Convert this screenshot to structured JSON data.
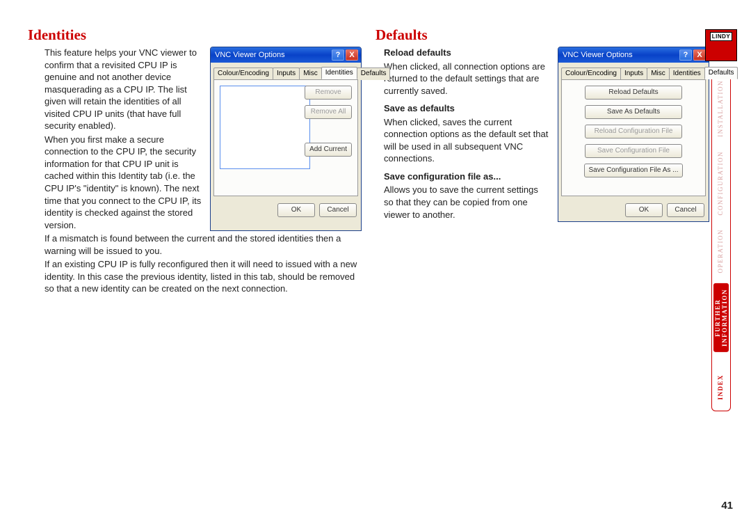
{
  "page_number": "41",
  "logo_text": "LINDY",
  "nav": {
    "items": [
      {
        "label": "INSTALLATION",
        "state": "muted"
      },
      {
        "label": "CONFIGURATION",
        "state": "muted"
      },
      {
        "label": "OPERATION",
        "state": "muted"
      },
      {
        "label": "FURTHER\nINFORMATION",
        "state": "active"
      },
      {
        "label": "INDEX",
        "state": "normal"
      }
    ]
  },
  "left": {
    "heading": "Identities",
    "p1": "This feature helps your VNC viewer to confirm that a revisited CPU IP is genuine and not another device masquerading as a CPU IP. The list given will retain the identities of all visited CPU IP units (that have full security enabled).",
    "p2": "When you first make a secure connection to the CPU IP, the security information for that CPU IP unit is cached within this Identity tab (i.e. the CPU IP's \"identity\" is known). The next time that you connect to the CPU IP, its identity is checked against the stored version.",
    "p3": "If a mismatch is found between the current and the stored identities then a warning will be issued to you.",
    "p4": "If an existing CPU IP is fully reconfigured then it will need to issued with a new identity. In this case the previous identity, listed in this tab, should be removed so that a new identity can be created on the next connection."
  },
  "right": {
    "heading": "Defaults",
    "items": [
      {
        "title": "Reload defaults",
        "body": "When clicked, all connection options are returned to the default settings that are currently saved."
      },
      {
        "title": "Save as defaults",
        "body": "When clicked, saves the current connection options as the default set that will be used in all subsequent VNC connections."
      },
      {
        "title": "Save configuration file as...",
        "body": "Allows you to save the current settings so that they can be copied from one viewer to another."
      }
    ]
  },
  "dialog": {
    "title": "VNC Viewer Options",
    "help": "?",
    "close": "X",
    "tabs": [
      "Colour/Encoding",
      "Inputs",
      "Misc",
      "Identities",
      "Defaults"
    ],
    "identities_buttons": {
      "remove": "Remove",
      "remove_all": "Remove All",
      "add_current": "Add Current"
    },
    "defaults_buttons": {
      "reload": "Reload Defaults",
      "saveas": "Save As Defaults",
      "reloadcfg": "Reload Configuration File",
      "savecfg": "Save Configuration File",
      "savecfgas": "Save Configuration File As ..."
    },
    "ok": "OK",
    "cancel": "Cancel"
  }
}
